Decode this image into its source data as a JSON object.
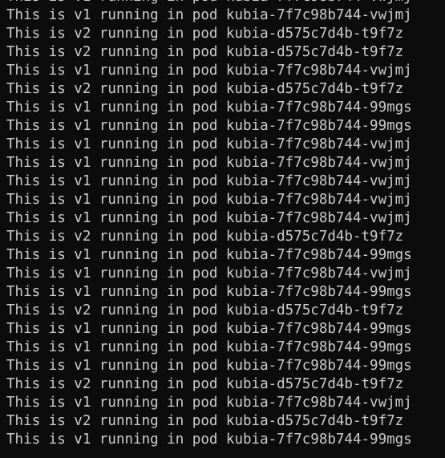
{
  "terminal": {
    "lines": [
      "This is v1 running in pod kubia-7f7c98b744-vwjmj",
      "This is v1 running in pod kubia-7f7c98b744-vwjmj",
      "This is v2 running in pod kubia-d575c7d4b-t9f7z",
      "This is v2 running in pod kubia-d575c7d4b-t9f7z",
      "This is v1 running in pod kubia-7f7c98b744-vwjmj",
      "This is v2 running in pod kubia-d575c7d4b-t9f7z",
      "This is v1 running in pod kubia-7f7c98b744-99mgs",
      "This is v1 running in pod kubia-7f7c98b744-99mgs",
      "This is v1 running in pod kubia-7f7c98b744-vwjmj",
      "This is v1 running in pod kubia-7f7c98b744-vwjmj",
      "This is v1 running in pod kubia-7f7c98b744-vwjmj",
      "This is v1 running in pod kubia-7f7c98b744-vwjmj",
      "This is v1 running in pod kubia-7f7c98b744-vwjmj",
      "This is v2 running in pod kubia-d575c7d4b-t9f7z",
      "This is v1 running in pod kubia-7f7c98b744-99mgs",
      "This is v1 running in pod kubia-7f7c98b744-vwjmj",
      "This is v1 running in pod kubia-7f7c98b744-99mgs",
      "This is v2 running in pod kubia-d575c7d4b-t9f7z",
      "This is v1 running in pod kubia-7f7c98b744-99mgs",
      "This is v1 running in pod kubia-7f7c98b744-99mgs",
      "This is v1 running in pod kubia-7f7c98b744-99mgs",
      "This is v2 running in pod kubia-d575c7d4b-t9f7z",
      "This is v1 running in pod kubia-7f7c98b744-vwjmj",
      "This is v2 running in pod kubia-d575c7d4b-t9f7z",
      "This is v1 running in pod kubia-7f7c98b744-99mgs"
    ],
    "colors": {
      "background": "#0c0c0c",
      "foreground": "#cccccc"
    }
  }
}
